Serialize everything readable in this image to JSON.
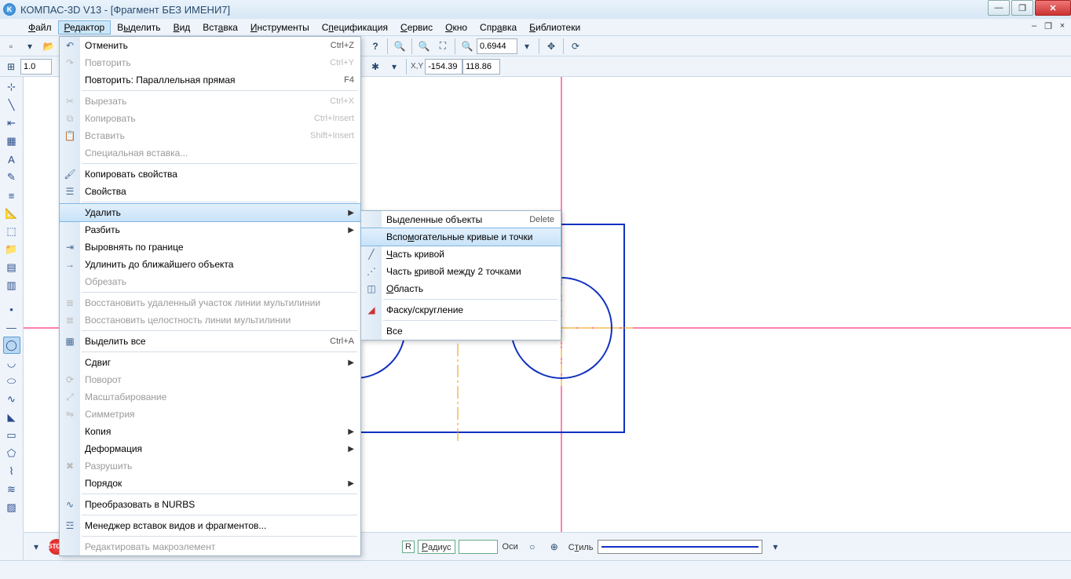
{
  "title": "КОМПАС-3D V13 - [Фрагмент БЕЗ ИМЕНИ7]",
  "menu": {
    "file": "Файл",
    "editor": "Редактор",
    "select": "Выделить",
    "view": "Вид",
    "insert": "Вставка",
    "tools": "Инструменты",
    "spec": "Спецификация",
    "service": "Сервис",
    "window": "Окно",
    "help": "Справка",
    "libs": "Библиотеки"
  },
  "toolbar1": {
    "step": "1.0"
  },
  "toolbar_top": {
    "zoom": "0.6944"
  },
  "coords": {
    "x": "-154.39",
    "y": "118.86"
  },
  "editor_menu": {
    "undo": "Отменить",
    "undo_sc": "Ctrl+Z",
    "redo": "Повторить",
    "redo_sc": "Ctrl+Y",
    "repeat": "Повторить: Параллельная прямая",
    "repeat_sc": "F4",
    "cut": "Вырезать",
    "cut_sc": "Ctrl+X",
    "copy": "Копировать",
    "copy_sc": "Ctrl+Insert",
    "paste": "Вставить",
    "paste_sc": "Shift+Insert",
    "paste_special": "Специальная вставка...",
    "copy_props": "Копировать свойства",
    "props": "Свойства",
    "delete": "Удалить",
    "split": "Разбить",
    "align": "Выровнять по границе",
    "extend": "Удлинить до ближайшего объекта",
    "trim": "Обрезать",
    "restore_ml": "Восстановить удаленный участок линии мультилинии",
    "restore_int": "Восстановить целостность линии мультилинии",
    "select_all": "Выделить все",
    "select_all_sc": "Ctrl+A",
    "shift": "Сдвиг",
    "rotate": "Поворот",
    "scale": "Масштабирование",
    "symmetry": "Симметрия",
    "copy_op": "Копия",
    "deform": "Деформация",
    "destroy": "Разрушить",
    "order": "Порядок",
    "nurbs": "Преобразовать в NURBS",
    "manager": "Менеджер вставок видов и фрагментов...",
    "macro": "Редактировать макроэлемент"
  },
  "delete_submenu": {
    "selected": "Выделенные объекты",
    "selected_sc": "Delete",
    "aux": "Вспомогательные кривые и точки",
    "part": "Часть кривой",
    "between": "Часть кривой между 2 точками",
    "region": "Область",
    "chamfer": "Фаску/скругление",
    "all": "Все"
  },
  "propbar": {
    "r_label": "R",
    "radius_label": "Радиус",
    "axes_label": "Оси",
    "style_label": "Стиль"
  }
}
